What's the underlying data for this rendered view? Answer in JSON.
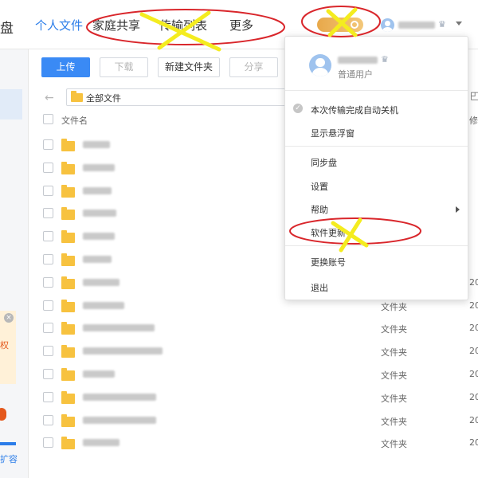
{
  "app": {
    "logo_tail": "盘"
  },
  "nav": {
    "tabs": [
      {
        "label": "个人文件",
        "active": true
      },
      {
        "label": "家庭共享",
        "active": false
      },
      {
        "label": "传输列表",
        "active": false
      },
      {
        "label": "更多",
        "active": false
      }
    ]
  },
  "sidebar": {
    "promo_text": "权",
    "expand_label": "扩容"
  },
  "toolbar": {
    "upload": "上传",
    "download": "下载",
    "new_folder": "新建文件夹",
    "share": "分享"
  },
  "path": {
    "current": "全部文件"
  },
  "table": {
    "header_name": "文件名",
    "header_modified": "修",
    "rows": [
      {
        "type": "",
        "date": ""
      },
      {
        "type": "",
        "date": ""
      },
      {
        "type": "",
        "date": ""
      },
      {
        "type": "",
        "date": ""
      },
      {
        "type": "",
        "date": ""
      },
      {
        "type": "",
        "date": ""
      },
      {
        "type": "",
        "date": "20"
      },
      {
        "type": "文件夹",
        "date": "20"
      },
      {
        "type": "文件夹",
        "date": "20"
      },
      {
        "type": "文件夹",
        "date": "20"
      },
      {
        "type": "文件夹",
        "date": "20"
      },
      {
        "type": "文件夹",
        "date": "20"
      },
      {
        "type": "文件夹",
        "date": "20"
      },
      {
        "type": "文件夹",
        "date": "20"
      }
    ]
  },
  "user_menu": {
    "user_level": "普通用户",
    "auto_shutdown": "本次传输完成自动关机",
    "float_window": "显示悬浮窗",
    "sync_disk": "同步盘",
    "settings": "设置",
    "help": "帮助",
    "software_update": "软件更新",
    "switch_account": "更换账号",
    "logout": "退出"
  },
  "colors": {
    "accent": "#2b7de9",
    "primary_button": "#3a8af5",
    "folder": "#f7c23f",
    "annotation_red": "#d9262b",
    "annotation_yellow": "#f4ec1f"
  }
}
